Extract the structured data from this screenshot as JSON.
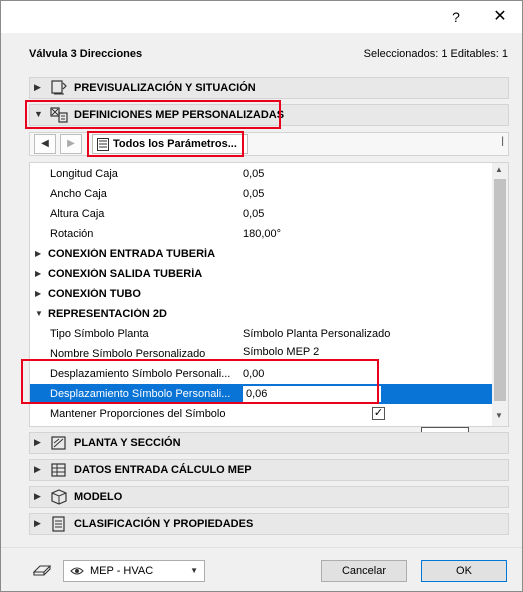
{
  "titlebar": {
    "help_glyph": "?",
    "close_glyph": "✕"
  },
  "header": {
    "title": "Válvula 3 Direcciones",
    "selection": "Seleccionados: 1 Editables: 1"
  },
  "panels": {
    "preview": "PREVISUALIZACIÓN Y SITUACIÓN",
    "mep_custom": "DEFINICIONES MEP PERSONALIZADAS",
    "plan_section": "PLANTA Y SECCIÓN",
    "mep_calc": "DATOS ENTRADA CÁLCULO MEP",
    "model": "MODELO",
    "classification": "CLASIFICACIÓN Y PROPIEDADES"
  },
  "nav": {
    "dropdown_label": "Todos los Parámetros...",
    "prev_glyph": "◀",
    "next_glyph": "▶",
    "more_glyph": "|"
  },
  "params": {
    "longitud_caja": {
      "name": "Longitud Caja",
      "value": "0,05"
    },
    "ancho_caja": {
      "name": "Ancho Caja",
      "value": "0,05"
    },
    "altura_caja": {
      "name": "Altura Caja",
      "value": "0,05"
    },
    "rotacion": {
      "name": "Rotación",
      "value": "180,00°"
    },
    "group_entrada": "CONEXIÓN ENTRADA TUBERÍA",
    "group_salida": "CONEXIÓN SALIDA TUBERÍA",
    "group_tubo": "CONEXIÓN TUBO",
    "group_repr": "REPRESENTACIÓN 2D",
    "tipo_simbolo": {
      "name": "Tipo Símbolo Planta",
      "value": "Símbolo Planta Personalizado"
    },
    "nombre_simbolo": {
      "name": "Nombre Símbolo Personalizado",
      "value": "Símbolo MEP 2"
    },
    "desp_1": {
      "name": "Desplazamiento Símbolo Personali...",
      "value": "0,00"
    },
    "desp_2": {
      "name": "Desplazamiento Símbolo Personali...",
      "value": "0,06"
    },
    "mantener": {
      "name": "Mantener Proporciones del Símbolo",
      "checked": "✓"
    }
  },
  "footer": {
    "mep_view": "MEP - HVAC",
    "cancel": "Cancelar",
    "ok": "OK"
  },
  "colors": {
    "highlight_red": "#e8001c",
    "selection_blue": "#0a74d6"
  }
}
